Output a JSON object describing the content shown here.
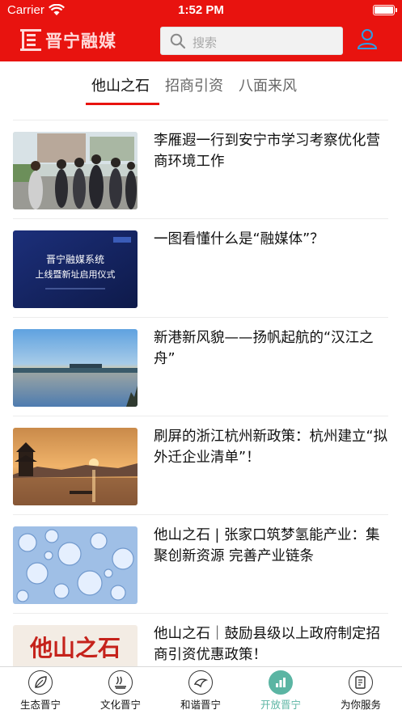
{
  "status_bar": {
    "carrier": "Carrier",
    "time": "1:52 PM"
  },
  "header": {
    "app_title": "晋宁融媒",
    "search_placeholder": "搜索",
    "brand_color": "#e8130f"
  },
  "tabs": [
    {
      "label": "他山之石",
      "active": true
    },
    {
      "label": "招商引资",
      "active": false
    },
    {
      "label": "八面来风",
      "active": false
    }
  ],
  "news": [
    {
      "title": "李雁遐一行到安宁市学习考察优化营商环境工作",
      "thumb": "meeting-photo"
    },
    {
      "title": "一图看懂什么是“融媒体”？",
      "thumb": "launch-ceremony-banner"
    },
    {
      "title": "新港新风貌——扬帆起航的“汉江之舟”",
      "thumb": "river-sunset-photo"
    },
    {
      "title": "刷屏的浙江杭州新政策：杭州建立“拟外迁企业清单”！",
      "thumb": "west-lake-sunset-photo"
    },
    {
      "title": "他山之石 | 张家口筑梦氢能产业：集聚创新资源 完善产业链条",
      "thumb": "water-bubbles-photo"
    },
    {
      "title": "他山之石｜鼓励县级以上政府制定招商引资优惠政策！",
      "thumb": "calligraphy-banner"
    }
  ],
  "thumb_texts": {
    "ceremony_line1": "晋宁融媒系统",
    "ceremony_line2": "上线暨新址启用仪式",
    "calligraphy": "他山之石"
  },
  "bottom_nav": [
    {
      "label": "生态晋宁",
      "icon": "leaf-icon",
      "active": false
    },
    {
      "label": "文化晋宁",
      "icon": "culture-icon",
      "active": false
    },
    {
      "label": "和谐晋宁",
      "icon": "dove-icon",
      "active": false
    },
    {
      "label": "开放晋宁",
      "icon": "chart-icon",
      "active": true
    },
    {
      "label": "为你服务",
      "icon": "service-icon",
      "active": false
    }
  ],
  "accent_active_nav": "#5bb5a3"
}
